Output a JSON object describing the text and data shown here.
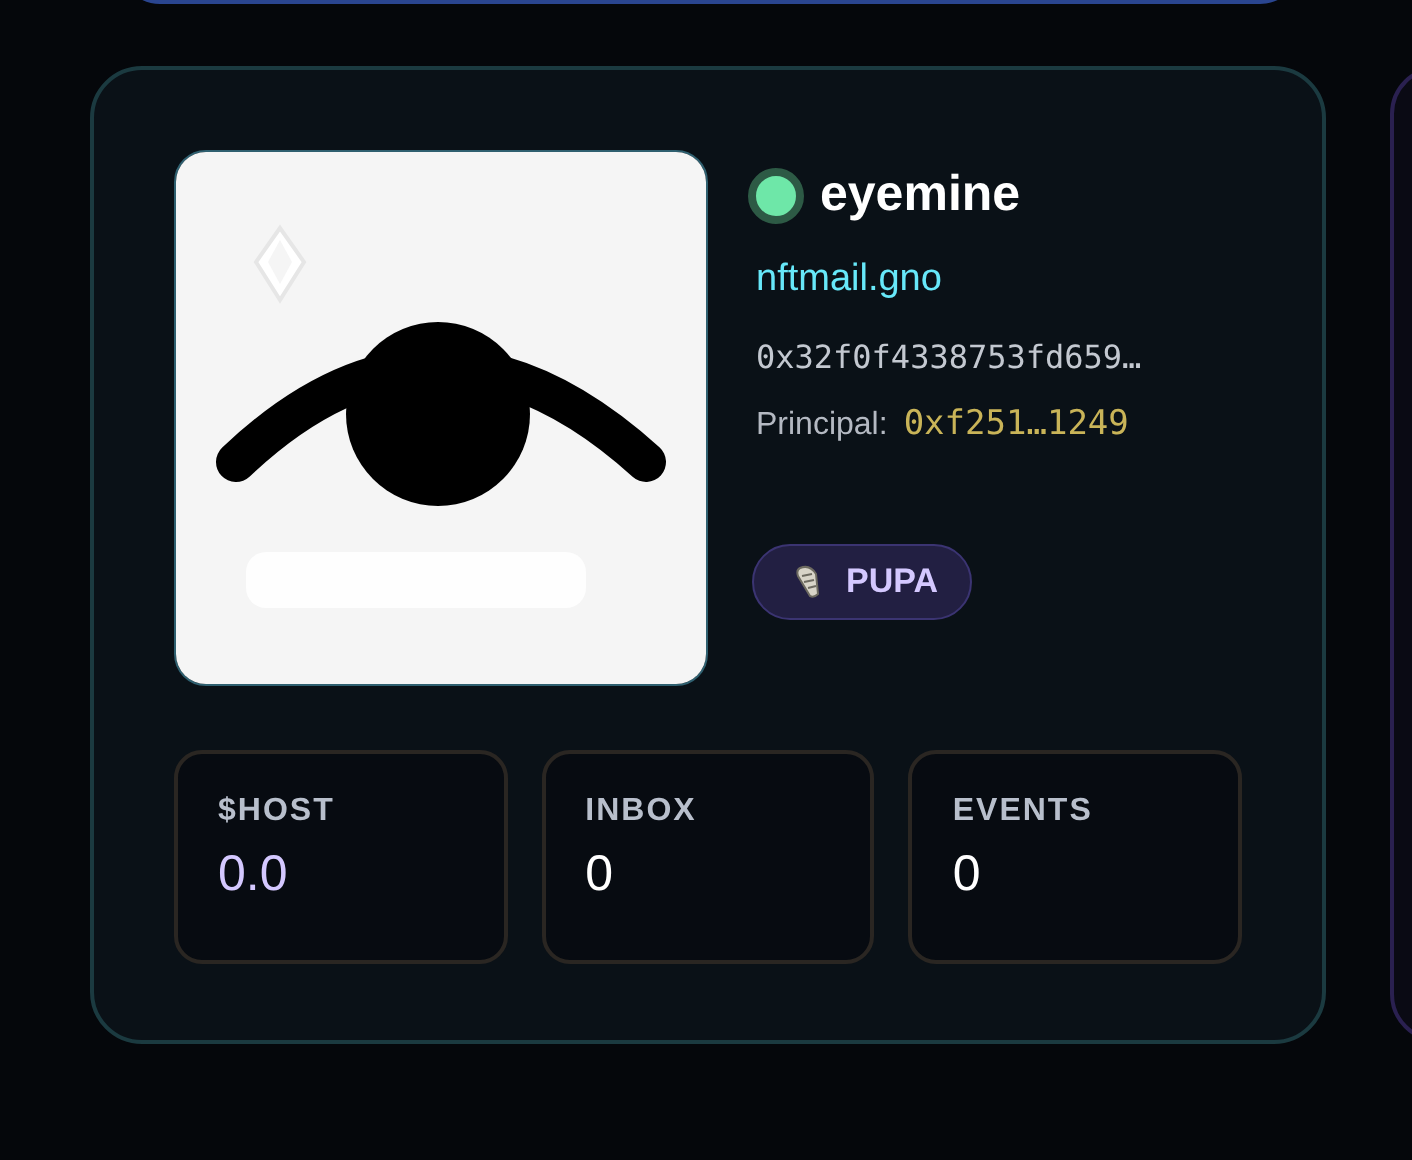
{
  "profile": {
    "name": "eyemine",
    "online": true,
    "domain": "nftmail.gno",
    "address": "0x32f0f4338753fd659…",
    "principal_label": "Principal:",
    "principal": "0xf251…1249",
    "badge": "PUPA"
  },
  "stats": [
    {
      "label": "$HOST",
      "value": "0.0",
      "kind": "token"
    },
    {
      "label": "INBOX",
      "value": "0",
      "kind": "count"
    },
    {
      "label": "EVENTS",
      "value": "0",
      "kind": "count"
    }
  ]
}
